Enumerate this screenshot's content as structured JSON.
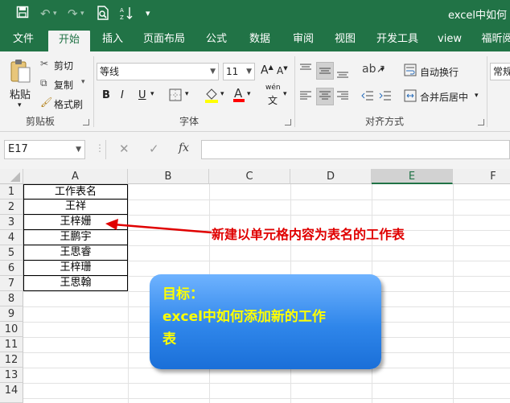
{
  "window": {
    "title": "excel中如何"
  },
  "quick_access": {
    "save": "save-icon",
    "undo": "undo-icon",
    "redo": "redo-icon",
    "preview": "print-preview-icon",
    "sort": "sort-icon",
    "more": "customize-icon"
  },
  "tabs": [
    "文件",
    "开始",
    "插入",
    "页面布局",
    "公式",
    "数据",
    "审阅",
    "视图",
    "开发工具",
    "view",
    "福昕阅"
  ],
  "active_tab": "开始",
  "ribbon": {
    "clipboard": {
      "paste": "粘贴",
      "cut": "剪切",
      "copy": "复制",
      "painter": "格式刷",
      "label": "剪贴板"
    },
    "font": {
      "name": "等线",
      "size": "11",
      "bold": "B",
      "italic": "I",
      "underline": "U",
      "phonetic": "wén",
      "label": "字体"
    },
    "alignment": {
      "wrap": "自动换行",
      "merge": "合并后居中",
      "label": "对齐方式"
    },
    "number": {
      "format": "常规"
    }
  },
  "formula_bar": {
    "name_box": "E17",
    "cancel": "✕",
    "enter": "✓",
    "fx": "fx",
    "value": ""
  },
  "sheet": {
    "columns": [
      "A",
      "B",
      "C",
      "D",
      "E",
      "F"
    ],
    "selected_column": "E",
    "rows": [
      "1",
      "2",
      "3",
      "4",
      "5",
      "6",
      "7",
      "8",
      "9",
      "10",
      "11",
      "12",
      "13",
      "14"
    ],
    "cells_A": [
      "工作表名",
      "王祥",
      "王梓姗",
      "王鹏宇",
      "王思睿",
      "王梓珊",
      "王思翰"
    ]
  },
  "annotation": {
    "text": "新建以单元格内容为表名的工作表",
    "color": "#e00000"
  },
  "callout": {
    "line1": "目标：",
    "line2": "excel中如何添加新的工作",
    "line3": "表"
  },
  "colors": {
    "accent": "#217346",
    "callout_text": "#ffff00"
  }
}
